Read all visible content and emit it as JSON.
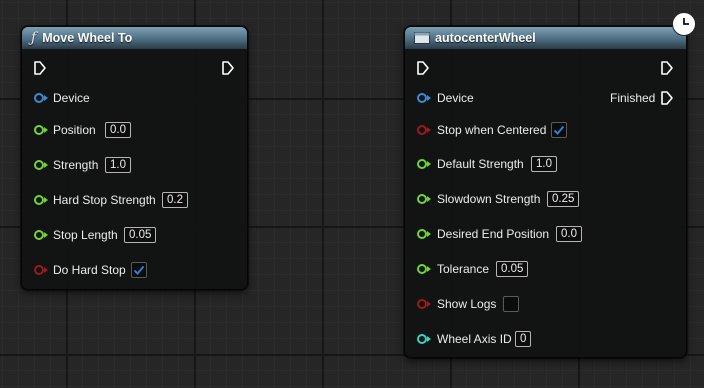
{
  "nodes": {
    "move_wheel_to": {
      "title": "Move Wheel To",
      "title_icon": "ƒ",
      "inputs": [
        {
          "label": "Device",
          "type": "object"
        },
        {
          "label": "Position",
          "value": "0.0"
        },
        {
          "label": "Strength",
          "value": "1.0"
        },
        {
          "label": "Hard Stop Strength",
          "value": "0.2"
        },
        {
          "label": "Stop Length",
          "value": "0.05"
        },
        {
          "label": "Do Hard Stop",
          "checked": true
        }
      ]
    },
    "autocenter_wheel": {
      "title": "autocenterWheel",
      "title_icon": "macro-icon",
      "outputs": [
        {
          "label": "Finished"
        }
      ],
      "inputs": [
        {
          "label": "Device",
          "type": "object"
        },
        {
          "label": "Stop when Centered",
          "checked": true
        },
        {
          "label": "Default Strength",
          "value": "1.0"
        },
        {
          "label": "Slowdown Strength",
          "value": "0.25"
        },
        {
          "label": "Desired End Position",
          "value": "0.0"
        },
        {
          "label": "Tolerance",
          "value": "0.05"
        },
        {
          "label": "Show Logs",
          "checked": false
        },
        {
          "label": "Wheel Axis ID",
          "value": "0"
        }
      ]
    }
  },
  "colors": {
    "object_pin": "#3b8bd6",
    "float_pin": "#70d43c",
    "bool_pin": "#9c1a1a",
    "int_pin": "#35d6c0",
    "checkbox": "#2c7fd6"
  },
  "latent_icon": "clock-icon"
}
